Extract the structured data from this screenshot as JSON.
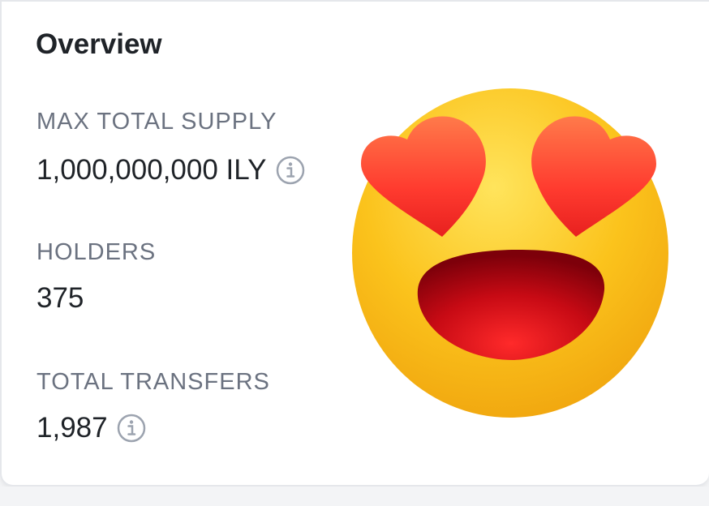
{
  "overview": {
    "title": "Overview",
    "stats": [
      {
        "label": "MAX TOTAL SUPPLY",
        "value": "1,000,000,000 ILY",
        "has_info_icon": true
      },
      {
        "label": "HOLDERS",
        "value": "375",
        "has_info_icon": false
      },
      {
        "label": "TOTAL TRANSFERS",
        "value": "1,987",
        "has_info_icon": true
      }
    ]
  },
  "sticker": {
    "icon": "heart-eyes-emoji",
    "colors": {
      "face": "#f7c21a",
      "heart": "#ff3b2f",
      "mouth": "#b0000d"
    }
  },
  "colors": {
    "title": "#1f2328",
    "label": "#6b7280",
    "value": "#1f2328",
    "info_icon": "#9ca3af",
    "card_border": "#e5e7eb"
  }
}
